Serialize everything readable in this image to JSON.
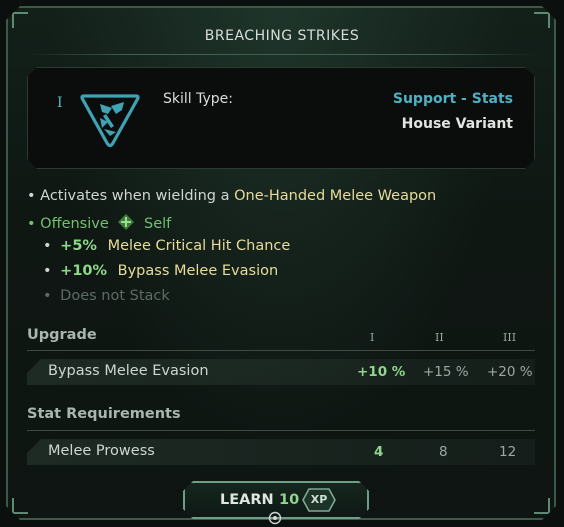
{
  "title": "BREACHING STRIKES",
  "header": {
    "tier_glyph": "I",
    "skill_type_label": "Skill Type:",
    "skill_type_value": "Support - Stats",
    "variant": "House Variant",
    "icon": "axe-emblem-icon"
  },
  "description": {
    "activates_prefix": "• Activates when wielding a",
    "activates_weapon": "One-Handed Melee Weapon",
    "target_bullet": "•",
    "target_offensive": "Offensive",
    "target_icon": "diamond-cross-icon",
    "target_self": "Self",
    "effects": [
      {
        "bullet": "•",
        "value": "+5%",
        "text": "Melee Critical Hit Chance"
      },
      {
        "bullet": "•",
        "value": "+10%",
        "text": "Bypass Melee Evasion"
      }
    ],
    "stack_bullet": "•",
    "stack_note": "Does not Stack"
  },
  "upgrade": {
    "heading": "Upgrade",
    "tiers": [
      "I",
      "II",
      "III"
    ],
    "row_label": "Bypass Melee Evasion",
    "values": [
      "+10 %",
      "+15 %",
      "+20 %"
    ]
  },
  "requirements": {
    "heading": "Stat Requirements",
    "row_label": "Melee Prowess",
    "values": [
      "4",
      "8",
      "12"
    ]
  },
  "learn": {
    "label": "LEARN",
    "cost": "10",
    "currency": "XP"
  },
  "colors": {
    "accent_teal": "#4fb0c2",
    "value_green": "#8fd58b",
    "highlight_yellow": "#e6dc9a"
  }
}
